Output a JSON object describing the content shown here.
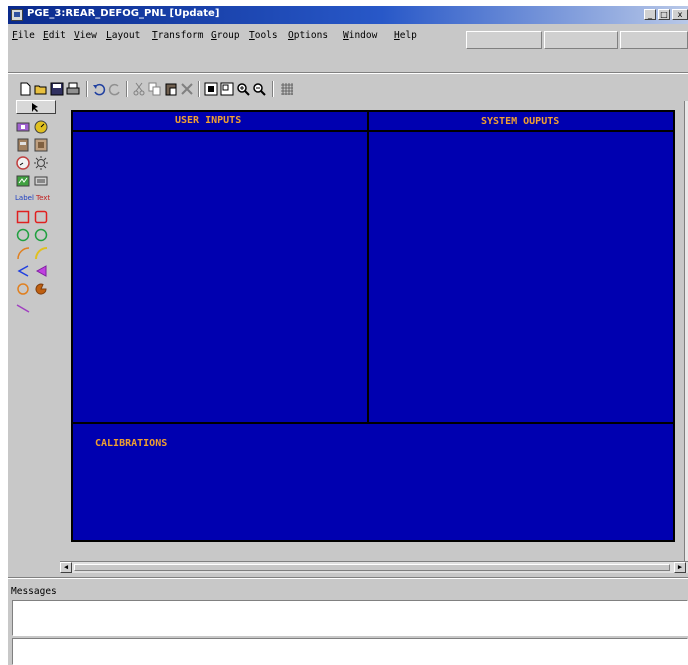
{
  "window": {
    "title": "PGE_3:REAR_DEFOG_PNL  [Update]",
    "controls": [
      "_",
      "□",
      "x"
    ]
  },
  "menubar": {
    "items": [
      "File",
      "Edit",
      "View",
      "Layout",
      "Transform",
      "Group",
      "Tools",
      "Options",
      "Window",
      "Help"
    ]
  },
  "toolbar": {
    "icons": [
      "new-document-icon",
      "open-folder-icon",
      "save-icon",
      "print-icon",
      "undo-icon",
      "redo-icon",
      "cut-icon",
      "copy-icon",
      "paste-icon",
      "delete-icon",
      "fit-window-icon",
      "zoom-area-icon",
      "zoom-in-icon",
      "zoom-out-icon",
      "grid-icon"
    ]
  },
  "palette": {
    "label_tool": "Label",
    "text_tool": "Text",
    "icons": [
      "select-arrow-icon",
      "slider-widget-icon",
      "gauge-widget-icon",
      "button-widget-icon",
      "led-widget-icon",
      "dial-icon",
      "lamp-icon",
      "display-widget-icon",
      "numeric-widget-icon",
      "rectangle-icon",
      "rounded-rectangle-icon",
      "circle-icon",
      "filled-circle-icon",
      "arc-icon",
      "filled-arc-icon",
      "chord-icon",
      "filled-chord-icon",
      "pie-icon",
      "filled-pie-icon",
      "line-icon"
    ]
  },
  "panel": {
    "user_inputs": "USER INPUTS",
    "system_outputs": "SYSTEM OUPUTS",
    "calibrations": "CALIBRATIONS",
    "background": "#0000b0",
    "label_color": "#f0a030"
  },
  "messages": {
    "label": "Messages"
  },
  "colors": {
    "title_bar": "#0a2a8c",
    "window_bg": "#c8c8c8"
  }
}
